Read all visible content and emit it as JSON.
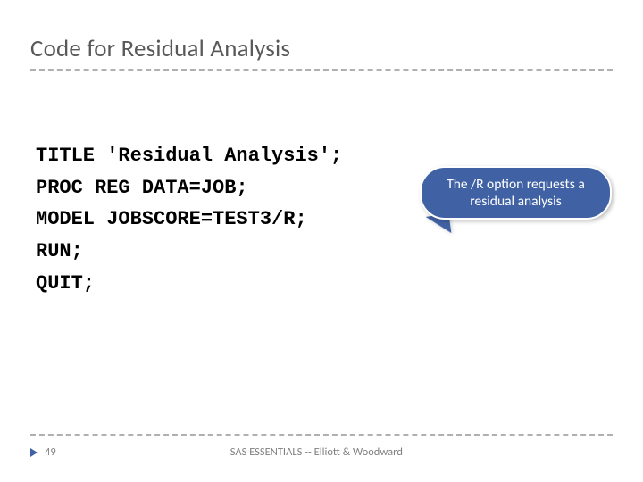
{
  "title": "Code for Residual Analysis",
  "code": {
    "l1": "TITLE 'Residual Analysis';",
    "l2": "PROC REG DATA=JOB;",
    "l3": "MODEL JOBSCORE=TEST3/R;",
    "l4": "RUN;",
    "l5": "QUIT;"
  },
  "callout": "The /R option requests a residual analysis",
  "footer": {
    "page": "49",
    "text": "SAS ESSENTIALS -- Elliott & Woodward"
  }
}
